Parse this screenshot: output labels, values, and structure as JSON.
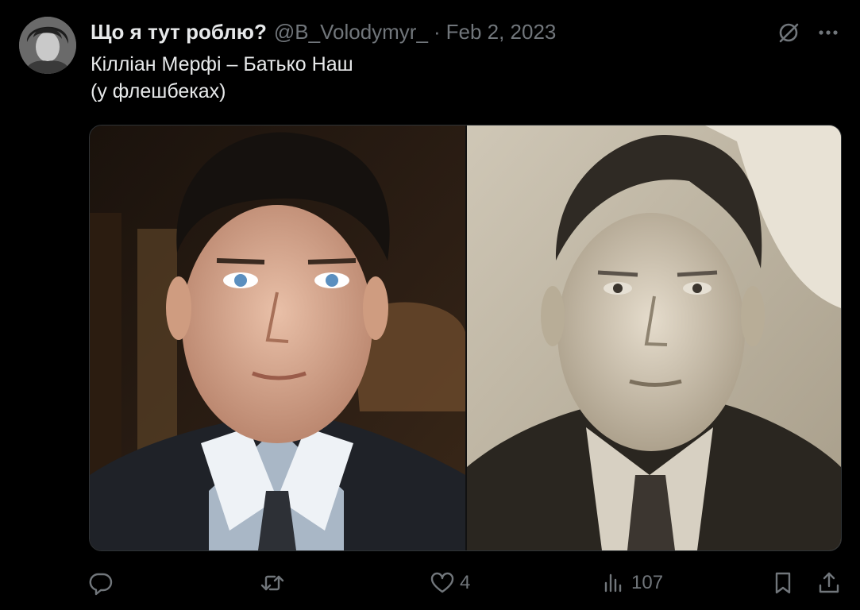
{
  "tweet": {
    "display_name": "Що я тут роблю?",
    "handle": "@B_Volodymyr_",
    "separator": "·",
    "date": "Feb 2, 2023",
    "text_lines": [
      "Кілліан Мерфі – Батько Наш",
      "(у флешбеках)"
    ]
  },
  "icons": {
    "grok": "grok-slash-icon",
    "more": "more-dots-icon",
    "reply": "reply-bubble-icon",
    "retweet": "retweet-arrows-icon",
    "like": "heart-icon",
    "views": "bar-chart-icon",
    "bookmark": "bookmark-icon",
    "share": "share-upload-icon"
  },
  "actions": {
    "likes": "4",
    "views": "107"
  },
  "colors": {
    "background": "#000000",
    "primary_text": "#e7e9ea",
    "secondary_text": "#71767b",
    "border": "#2f3336"
  }
}
